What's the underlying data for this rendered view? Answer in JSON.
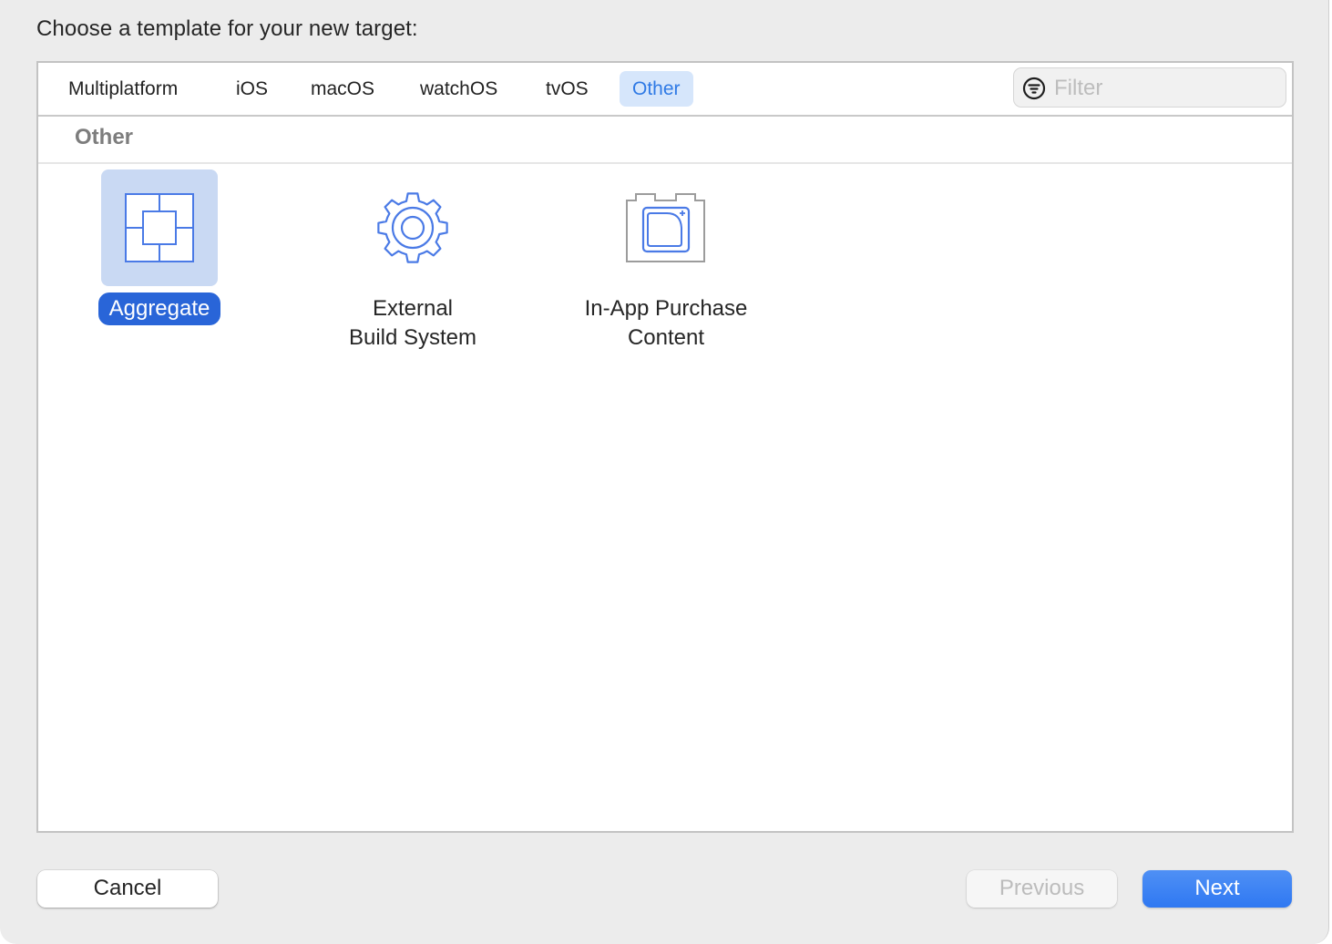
{
  "dialog": {
    "title": "Choose a template for your new target:"
  },
  "tabs": [
    {
      "label": "Multiplatform",
      "active": false
    },
    {
      "label": "iOS",
      "active": false
    },
    {
      "label": "macOS",
      "active": false
    },
    {
      "label": "watchOS",
      "active": false
    },
    {
      "label": "tvOS",
      "active": false
    },
    {
      "label": "Other",
      "active": true
    }
  ],
  "filter": {
    "placeholder": "Filter",
    "value": "",
    "icon": "filter-icon"
  },
  "section": {
    "title": "Other"
  },
  "templates": [
    {
      "label": "Aggregate",
      "icon": "aggregate-icon",
      "selected": true
    },
    {
      "label": "External\nBuild System",
      "icon": "gear-icon",
      "selected": false
    },
    {
      "label": "In-App Purchase\nContent",
      "icon": "in-app-purchase-icon",
      "selected": false
    }
  ],
  "buttons": {
    "cancel": "Cancel",
    "previous": "Previous",
    "next": "Next"
  },
  "colors": {
    "accent": "#2f7ae5",
    "selection": "#2965d8",
    "icon_stroke": "#4a7ae6"
  }
}
